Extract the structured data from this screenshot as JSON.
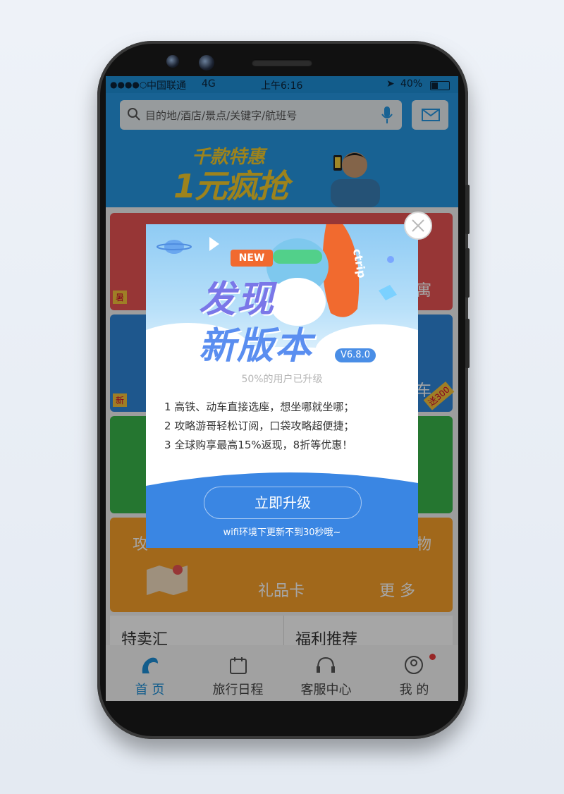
{
  "statusbar": {
    "signal": "●●●●○",
    "carrier": "中国联通",
    "network": "4G",
    "time": "上午6:16",
    "battery": "40%"
  },
  "search": {
    "placeholder": "目的地/酒店/景点/关键字/航班号",
    "icon": "search-icon",
    "voice_icon": "microphone-icon",
    "message_icon": "envelope-icon"
  },
  "banner": {
    "line1": "千款特惠",
    "line2": "1元疯抢"
  },
  "tiles": {
    "t1": "寓",
    "t2": "车",
    "t3": "攻",
    "t4": "物",
    "t5": "礼品卡",
    "t6": "更 多",
    "badge1": "暑",
    "badge2": "新",
    "badge3": "送300"
  },
  "cards": {
    "left_title": "特卖汇",
    "right_title": "福利推荐"
  },
  "tabbar": {
    "home": "首 页",
    "trip": "旅行日程",
    "service": "客服中心",
    "mine": "我 的"
  },
  "modal": {
    "new_badge": "NEW",
    "headline1": "发现",
    "headline2": "新版本",
    "version": "V6.8.0",
    "upgraded": "50%的用户已升级",
    "features": [
      "1 高铁、动车直接选座，想坐哪就坐哪；",
      "2 攻略游哥轻松订阅，口袋攻略超便捷；",
      "3 全球购享最高15%返现，8折等优惠！"
    ],
    "button": "立即升级",
    "note": "wifi环境下更新不到30秒哦~",
    "rocket_text": "ctrip"
  },
  "colors": {
    "brand_blue": "#2597e2",
    "modal_blue": "#3a86e3",
    "tile_red": "#e85454",
    "tile_blue": "#2f86d9",
    "tile_green": "#39b54a",
    "tile_orange": "#f7a02a"
  }
}
